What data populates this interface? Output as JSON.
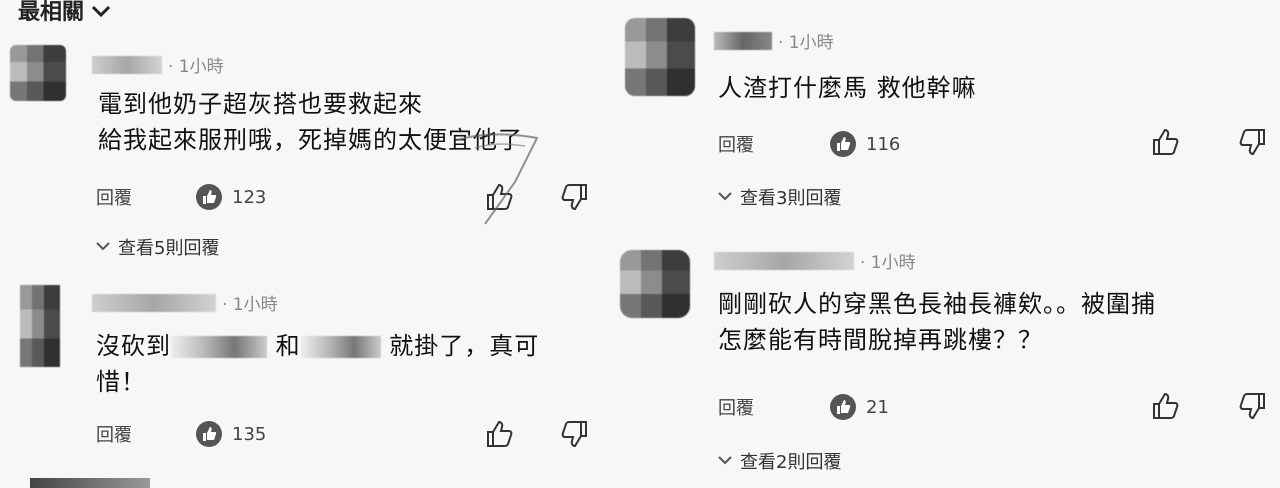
{
  "sort": {
    "label": "最相關"
  },
  "comments": [
    {
      "time": "· 1小時",
      "line1": "電到他奶子超灰搭也要救起來",
      "line2": "給我起來服刑哦，死掉媽的太便宜他了",
      "reply_label": "回覆",
      "likes": "123",
      "view_replies": "查看5則回覆"
    },
    {
      "time": "· 1小時",
      "line1_a": "沒砍到",
      "line1_b": "和",
      "line1_c": "就掛了，真可",
      "line2": "惜！",
      "reply_label": "回覆",
      "likes": "135"
    },
    {
      "time": "· 1小時",
      "line1": "人渣打什麼馬 救他幹嘛",
      "reply_label": "回覆",
      "likes": "116",
      "view_replies": "查看3則回覆"
    },
    {
      "time": "· 1小時",
      "line1": "剛剛砍人的穿黑色長袖長褲欸。。被圍捕",
      "line2": "怎麼能有時間脫掉再跳樓？？",
      "reply_label": "回覆",
      "likes": "21",
      "view_replies": "查看2則回覆"
    }
  ],
  "icons": {
    "like": "thumbs-up-icon",
    "dislike": "thumbs-down-icon",
    "chevron": "chevron-down-icon"
  }
}
